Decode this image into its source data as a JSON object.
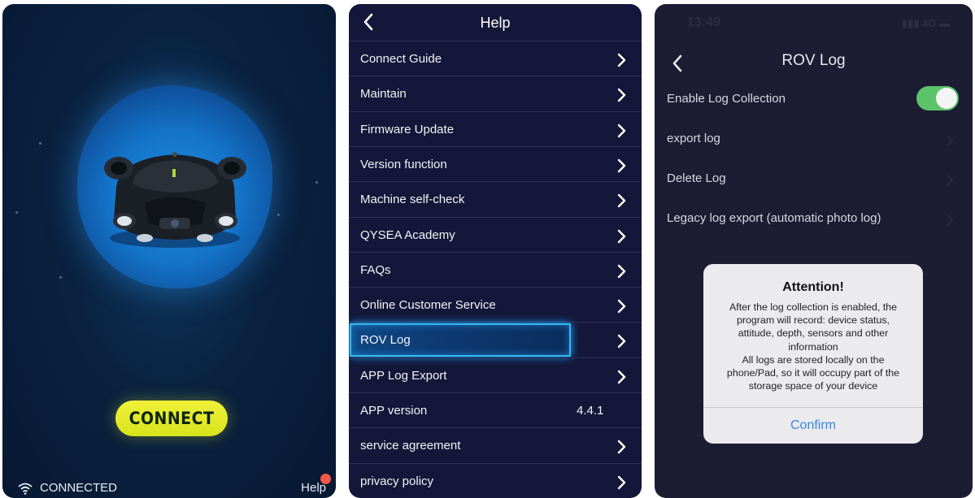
{
  "connect_screen": {
    "connect_label": "CONNECT",
    "status_label": "CONNECTED",
    "help_label": "Help"
  },
  "help_screen": {
    "title": "Help",
    "items": [
      {
        "label": "Connect Guide"
      },
      {
        "label": "Maintain"
      },
      {
        "label": "Firmware Update"
      },
      {
        "label": "Version function"
      },
      {
        "label": "Machine self-check"
      },
      {
        "label": "QYSEA Academy"
      },
      {
        "label": "FAQs"
      },
      {
        "label": "Online Customer Service"
      },
      {
        "label": "ROV Log"
      },
      {
        "label": "APP Log Export"
      },
      {
        "label": "APP version",
        "value": "4.4.1"
      },
      {
        "label": "service agreement"
      },
      {
        "label": "privacy policy"
      }
    ]
  },
  "rov_log_screen": {
    "status_time": "13:49",
    "status_network": "4G",
    "title": "ROV Log",
    "enable_label": "Enable Log Collection",
    "enable_on": true,
    "items": [
      {
        "label": "export log"
      },
      {
        "label": "Delete Log"
      },
      {
        "label": "Legacy log export (automatic photo log)"
      }
    ],
    "dialog": {
      "title": "Attention!",
      "lines": [
        "After the log collection is enabled, the",
        "program will record: device status,",
        "attitude, depth, sensors and other",
        "information",
        "All logs are stored locally on the",
        "phone/Pad, so it will occupy part of the",
        "storage space of your device"
      ],
      "confirm_label": "Confirm"
    },
    "colors": {
      "toggle_on": "#5cc36b",
      "confirm": "#3a86e8"
    }
  },
  "colors": {
    "connect_button": "#e4ec2a",
    "highlight_border": "#35b9f0",
    "help_badge": "#f2574a"
  }
}
